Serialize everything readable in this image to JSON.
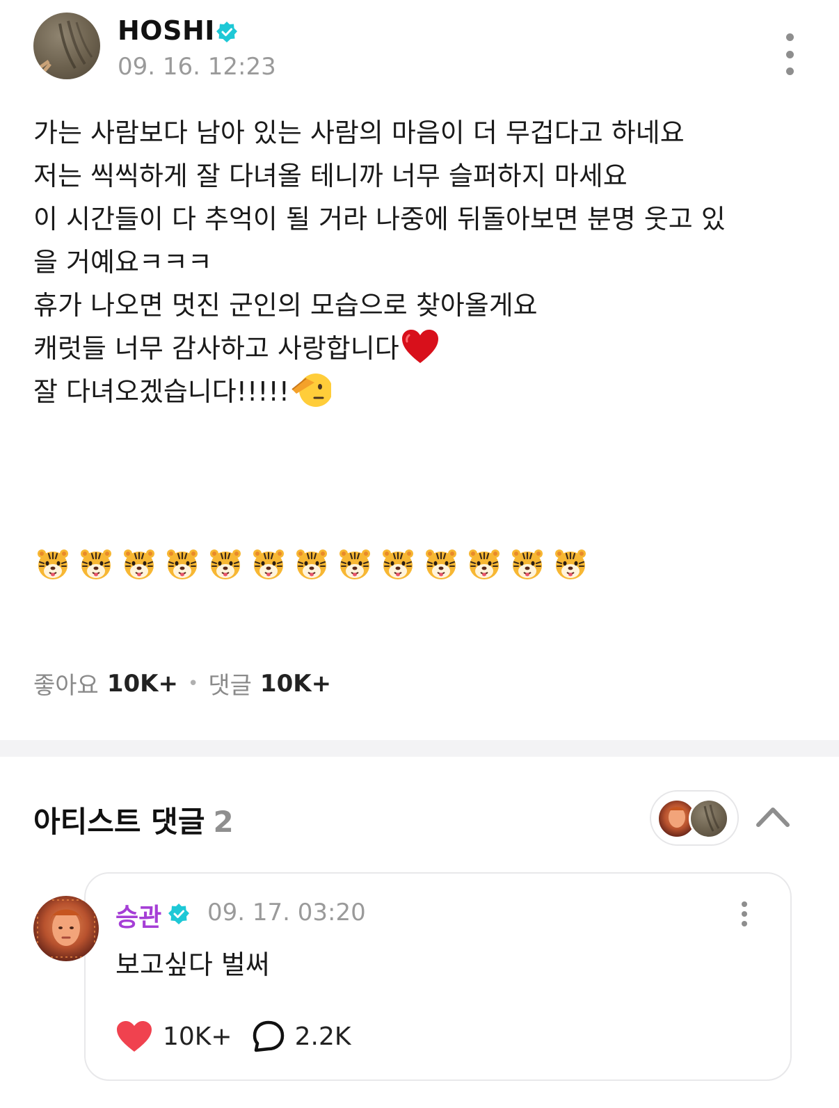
{
  "post": {
    "author": "HOSHI",
    "timestamp": "09. 16. 12:23",
    "lines": [
      "가는 사람보다 남아 있는 사람의 마음이 더 무겁다고 하네요",
      "저는 씩씩하게 잘 다녀올 테니까 너무 슬퍼하지 마세요",
      "이 시간들이 다 추억이 될 거라 나중에 뒤돌아보면 분명 웃고 있",
      "을 거예요ㅋㅋㅋ",
      "휴가 나오면 멋진 군인의 모습으로 찾아올게요",
      "캐럿들 너무 감사하고 사랑합니다",
      "잘 다녀오겠습니다!!!!!"
    ],
    "emoji": {
      "heart": "red-heart",
      "salute": "saluting-face",
      "tiger": "tiger-face",
      "tiger_count": 13
    },
    "stats": {
      "likes_label": "좋아요",
      "likes_value": "10K+",
      "comments_label": "댓글",
      "comments_value": "10K+"
    }
  },
  "artist_comments": {
    "title": "아티스트 댓글",
    "count": "2",
    "items": [
      {
        "author": "승관",
        "timestamp": "09. 17. 03:20",
        "text": "보고싶다 벌써",
        "likes": "10K+",
        "replies": "2.2K"
      }
    ]
  },
  "colors": {
    "verified_badge": "#1ec8d6",
    "comment_author": "#a53ed6",
    "like_heart": "#f0424f",
    "muted_text": "#9a9a9a"
  }
}
